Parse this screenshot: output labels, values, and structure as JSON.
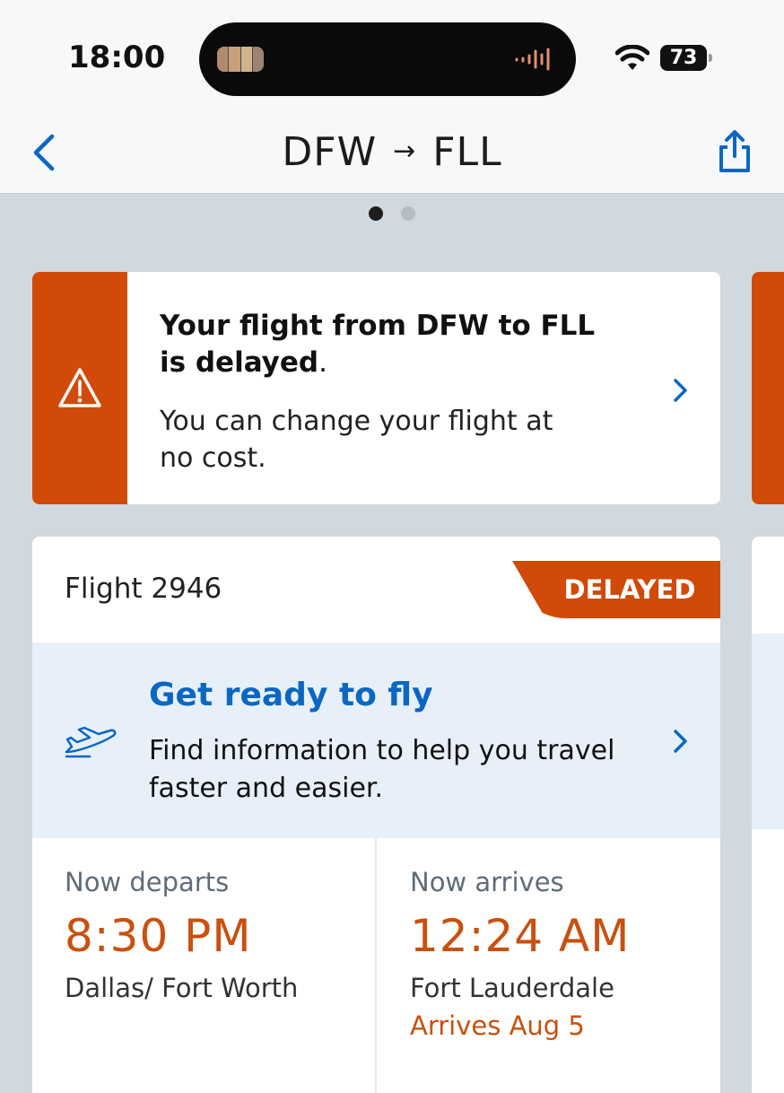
{
  "status_bar": {
    "time": "18:00",
    "battery": "73"
  },
  "nav": {
    "origin": "DFW",
    "arrow": "→",
    "destination": "FLL"
  },
  "alert": {
    "title_part": "Your flight from DFW to FLL is delayed",
    "title_end": ".",
    "body": "You can change your flight at no cost."
  },
  "flight": {
    "number_label": "Flight 2946",
    "status": "DELAYED",
    "ready_title": "Get ready to fly",
    "ready_desc": "Find information to help you travel faster and easier.",
    "departure": {
      "label": "Now departs",
      "time": "8:30 PM",
      "city": "Dallas/ Fort Worth"
    },
    "arrival": {
      "label": "Now arrives",
      "time": "12:24 AM",
      "city": "Fort Lauderdale",
      "note": "Arrives Aug 5"
    }
  },
  "colors": {
    "accent_orange": "#d14a08",
    "link_blue": "#0a67c2",
    "time_orange": "#c9500e",
    "info_bg": "#e7f0f9"
  },
  "icons": [
    "back-chevron-icon",
    "share-icon",
    "warning-icon",
    "chevron-right-icon",
    "airplane-icon",
    "wifi-icon",
    "battery-icon"
  ]
}
